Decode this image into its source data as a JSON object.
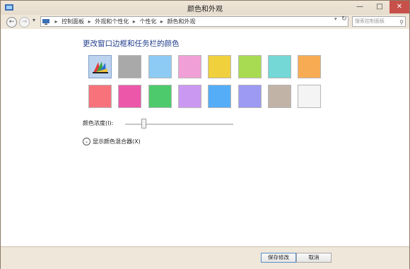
{
  "window": {
    "title": "颜色和外观"
  },
  "titlebar_buttons": {
    "minimize": "—",
    "maximize": "□",
    "close": "✕"
  },
  "address": {
    "crumbs": [
      "控制面板",
      "外观和个性化",
      "个性化",
      "颜色和外观"
    ],
    "search_placeholder": "搜索控制面板"
  },
  "main": {
    "heading": "更改窗口边框和任务栏的颜色",
    "colors": [
      {
        "name": "auto",
        "hex": "#bcd3ef"
      },
      {
        "name": "gray",
        "hex": "#a9a9a9"
      },
      {
        "name": "sky",
        "hex": "#8dcbf4"
      },
      {
        "name": "pink",
        "hex": "#f19fd7"
      },
      {
        "name": "yellow",
        "hex": "#f1d03e"
      },
      {
        "name": "lime",
        "hex": "#a9db52"
      },
      {
        "name": "teal",
        "hex": "#73d8d6"
      },
      {
        "name": "orange",
        "hex": "#f7ac53"
      },
      {
        "name": "red",
        "hex": "#f7727b"
      },
      {
        "name": "magenta",
        "hex": "#ec57a9"
      },
      {
        "name": "green",
        "hex": "#4dcb6c"
      },
      {
        "name": "violet",
        "hex": "#cb98f1"
      },
      {
        "name": "blue",
        "hex": "#55adf7"
      },
      {
        "name": "periwinkle",
        "hex": "#9c9af2"
      },
      {
        "name": "taupe",
        "hex": "#c1b3a6"
      },
      {
        "name": "white",
        "hex": "#f4f4f4"
      }
    ],
    "density_label": "颜色浓度(I):",
    "density_value": 0.17,
    "mixer_label": "显示颜色混合器(X)"
  },
  "footer": {
    "save_label": "保存修改",
    "cancel_label": "取消"
  }
}
